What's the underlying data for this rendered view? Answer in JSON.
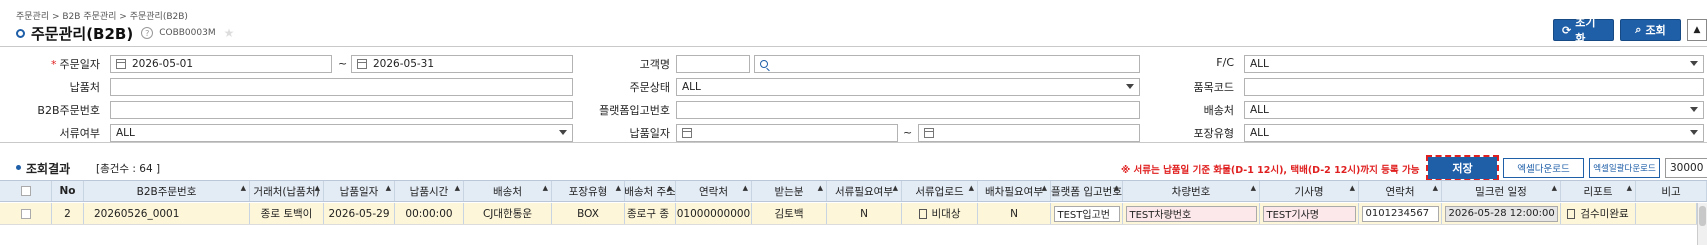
{
  "breadcrumb": "주문관리 > B2B 주문관리 > 주문관리(B2B)",
  "page": {
    "title": "주문관리(B2B)",
    "help_icon": "?",
    "screen_code": "COBB0003M",
    "star_icon": "★"
  },
  "top_buttons": {
    "reset": "초기화",
    "search": "조회",
    "collapse": "▲"
  },
  "search": {
    "order_date": {
      "label": "주문일자",
      "required_mark": "*",
      "from": "2026-05-01",
      "to": "2026-05-31",
      "sep": "~"
    },
    "customer": {
      "label": "고객명",
      "value": "",
      "search_value": ""
    },
    "fc": {
      "label": "F/C",
      "value": "ALL"
    },
    "supplier": {
      "label": "납품처",
      "value": ""
    },
    "order_status": {
      "label": "주문상태",
      "value": "ALL"
    },
    "item_code": {
      "label": "품목코드",
      "value": ""
    },
    "b2b_order_no": {
      "label": "B2B주문번호",
      "value": ""
    },
    "platform_receipt_no": {
      "label": "플랫폼입고번호",
      "value": ""
    },
    "delivery_point": {
      "label": "배송처",
      "value": "ALL"
    },
    "document_flag": {
      "label": "서류여부",
      "value": "ALL"
    },
    "delivery_date": {
      "label": "납품일자",
      "from": "",
      "to": "",
      "sep": "~"
    },
    "package_type": {
      "label": "포장유형",
      "value": "ALL"
    }
  },
  "result": {
    "title": "조회결과",
    "count_text": "[총건수 :  64 ]",
    "notice": "※ 서류는 납품일 기준 화물(D-1 12시), 택배(D-2 12시)까지 등록 가능",
    "save": "저장",
    "excel_download": "엑셀다운로드",
    "excel_bulk_download": "엑셀일괄다운로드",
    "page_size": "30000"
  },
  "grid": {
    "columns": [
      "",
      "No",
      "B2B주문번호",
      "거래처(납품처)",
      "납품일자",
      "납품시간",
      "배송처",
      "포장유형",
      "배송처 주소",
      "연락처",
      "받는분",
      "서류필요여부",
      "서류업로드",
      "배차필요여부",
      "플랫폼 입고번호",
      "차량번호",
      "기사명",
      "연락처",
      "밀크런 일정",
      "리포트",
      "비고"
    ],
    "rows": [
      {
        "no": "2",
        "b2b_order_no": "20260526_0001",
        "customer": "종로 토백이",
        "delivery_date": "2026-05-29",
        "delivery_time": "00:00:00",
        "delivery_point": "CJ대한통운",
        "package_type": "BOX",
        "address": "종로구 종",
        "phone": "01000000000",
        "receiver": "김토백",
        "doc_required": "N",
        "doc_upload": "비대상",
        "dispatch_required": "N",
        "platform_receipt_no": "TEST입고번",
        "vehicle_no": "TEST차량번호",
        "driver": "TEST기사명",
        "driver_phone": "0101234567",
        "milkrun": "2026-05-28 12:00:00",
        "report": "검수미완료",
        "remark": ""
      }
    ]
  }
}
